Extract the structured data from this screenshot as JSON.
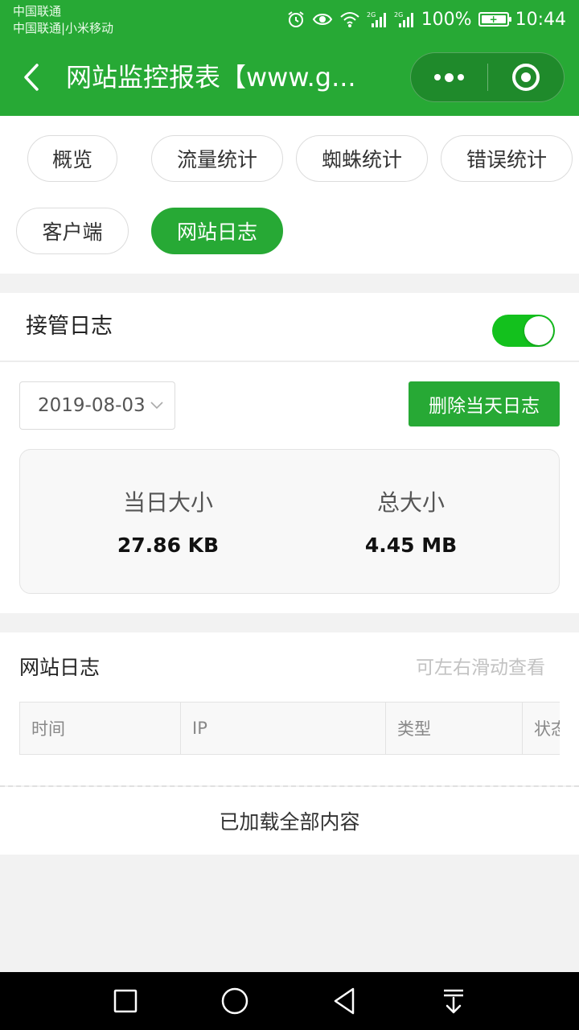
{
  "status_bar": {
    "carrier1": "中国联通",
    "carrier2": "中国联通|小米移动",
    "battery_percent": "100%",
    "time": "10:44",
    "network1": "2G",
    "network2": "2G"
  },
  "header": {
    "title": "网站监控报表【www.g..."
  },
  "tabs": [
    {
      "label": "概览"
    },
    {
      "label": "流量统计"
    },
    {
      "label": "蜘蛛统计"
    },
    {
      "label": "错误统计"
    },
    {
      "label": "客户端"
    },
    {
      "label": "网站日志"
    }
  ],
  "active_tab": "网站日志",
  "takeover": {
    "label": "接管日志",
    "enabled": true
  },
  "log_controls": {
    "date": "2019-08-03",
    "delete_label": "删除当天日志"
  },
  "stats": {
    "day_size_label": "当日大小",
    "day_size_value": "27.86 KB",
    "total_size_label": "总大小",
    "total_size_value": "4.45 MB"
  },
  "site_log": {
    "title": "网站日志",
    "hint": "可左右滑动查看",
    "columns": [
      "时间",
      "IP",
      "类型",
      "状态"
    ],
    "footer": "已加载全部内容"
  },
  "colors": {
    "brand_green": "#27a935",
    "toggle_green": "#13c11d"
  }
}
